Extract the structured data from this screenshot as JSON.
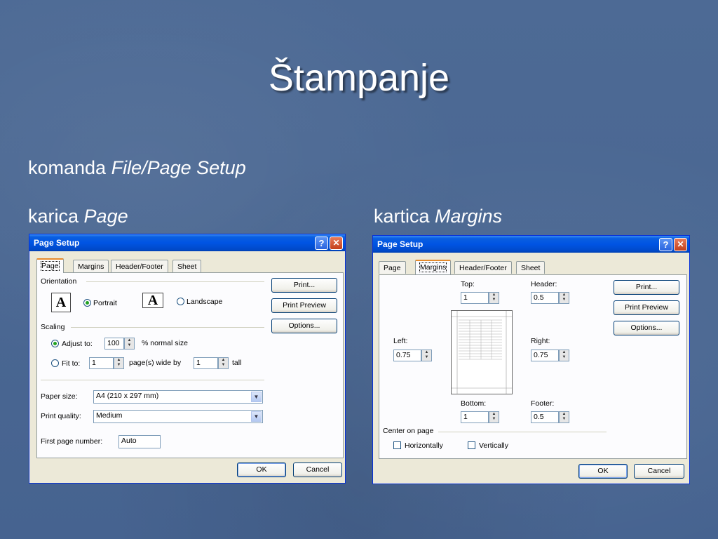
{
  "slide": {
    "title": "Štampanje",
    "line1_prefix": "komanda",
    "line1_italic": "File/Page Setup",
    "left_caption_prefix": "karica",
    "left_caption_italic": "Page",
    "right_caption_prefix": "kartica",
    "right_caption_italic": "Margins"
  },
  "dialog_page": {
    "title": "Page Setup",
    "tabs": [
      "Page",
      "Margins",
      "Header/Footer",
      "Sheet"
    ],
    "active_tab": "Page",
    "orientation_label": "Orientation",
    "portrait_label": "Portrait",
    "landscape_label": "Landscape",
    "orientation_icon": "A",
    "scaling_label": "Scaling",
    "adjust_to_label": "Adjust to:",
    "adjust_value": "100",
    "adjust_suffix": "% normal size",
    "fit_to_label": "Fit to:",
    "fit_wide_value": "1",
    "fit_wide_suffix": "page(s) wide by",
    "fit_tall_value": "1",
    "fit_tall_suffix": "tall",
    "paper_size_label": "Paper size:",
    "paper_size_value": "A4 (210 x 297 mm)",
    "print_quality_label": "Print quality:",
    "print_quality_value": "Medium",
    "first_page_label": "First page number:",
    "first_page_value": "Auto",
    "print_button": "Print...",
    "preview_button": "Print Preview",
    "options_button": "Options...",
    "ok_button": "OK",
    "cancel_button": "Cancel"
  },
  "dialog_margins": {
    "title": "Page Setup",
    "tabs": [
      "Page",
      "Margins",
      "Header/Footer",
      "Sheet"
    ],
    "active_tab": "Margins",
    "top_label": "Top:",
    "top_value": "1",
    "header_label": "Header:",
    "header_value": "0.5",
    "left_label": "Left:",
    "left_value": "0.75",
    "right_label": "Right:",
    "right_value": "0.75",
    "bottom_label": "Bottom:",
    "bottom_value": "1",
    "footer_label": "Footer:",
    "footer_value": "0.5",
    "center_label": "Center on page",
    "horizontally_label": "Horizontally",
    "vertically_label": "Vertically",
    "print_button": "Print...",
    "preview_button": "Print Preview",
    "options_button": "Options...",
    "ok_button": "OK",
    "cancel_button": "Cancel"
  },
  "icons": {
    "help": "?",
    "close": "✕",
    "dropdown": "▼",
    "spin_up": "▲",
    "spin_down": "▼"
  }
}
